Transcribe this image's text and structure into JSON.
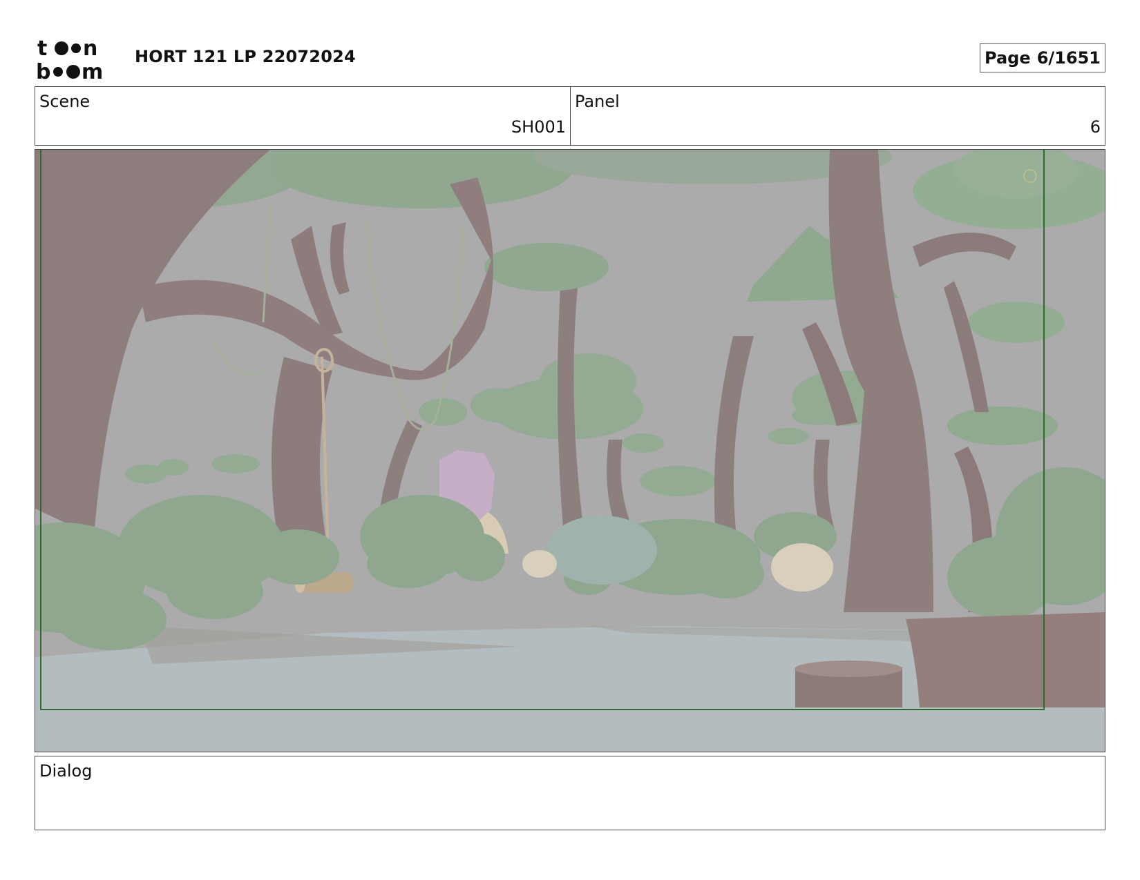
{
  "header": {
    "logo_text": "toon boom",
    "project_title": "HORT 121 LP 22072024",
    "page_label": "Page",
    "page_value": "6/1651"
  },
  "info": {
    "scene_label": "Scene",
    "scene_value": "SH001",
    "panel_label": "Panel",
    "panel_value": "6"
  },
  "frame": {
    "safe_area_color": "#2f6b2f",
    "sky_color": "#ababab",
    "ground_color": "#b3bcbe"
  },
  "dialog": {
    "label": "Dialog",
    "text": ""
  }
}
